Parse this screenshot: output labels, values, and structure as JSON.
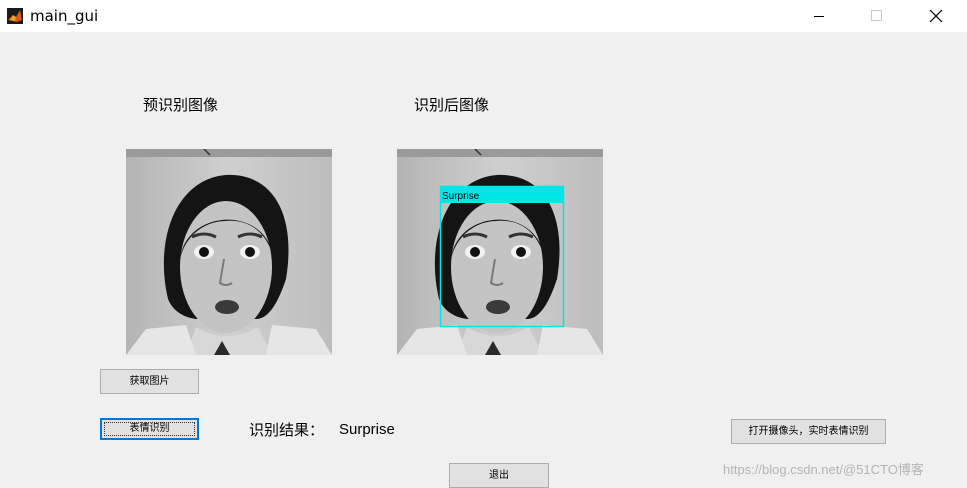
{
  "window": {
    "title": "main_gui",
    "icon": "matlab-icon",
    "controls": [
      "minimize-icon",
      "maximize-icon",
      "close-icon"
    ]
  },
  "panels": {
    "left_caption": "预识别图像",
    "right_caption": "识别后图像"
  },
  "detection": {
    "label": "Surprise",
    "box_color": "#00e5e5"
  },
  "buttons": {
    "get_image": "获取图片",
    "recognize": "表情识别",
    "camera": "打开摄像头，实时表情识别",
    "exit": "退出"
  },
  "result": {
    "label": "识别结果：",
    "value": "Surprise"
  },
  "watermark": "https://blog.csdn.net/@51CTO博客",
  "colors": {
    "background": "#f0f0f0",
    "titlebar": "#ffffff",
    "button_face": "#e1e1e1",
    "focus_border": "#0078d7"
  }
}
